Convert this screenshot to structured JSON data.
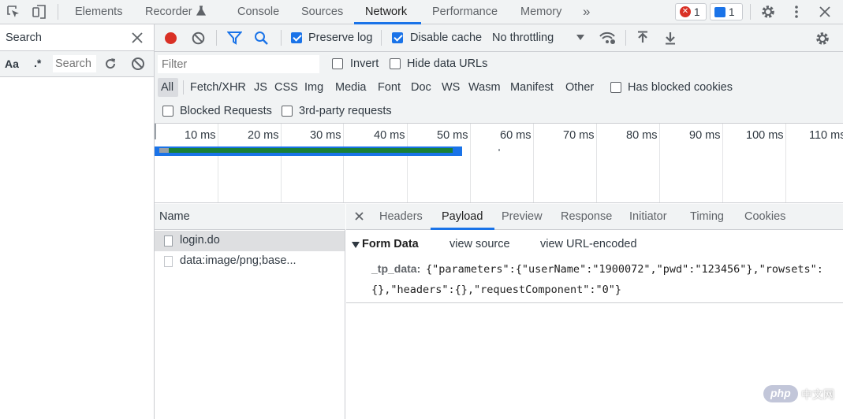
{
  "topbar": {
    "tabs": [
      {
        "label": "Elements"
      },
      {
        "label": "Recorder"
      },
      {
        "label": "Console"
      },
      {
        "label": "Sources"
      },
      {
        "label": "Network"
      },
      {
        "label": "Performance"
      },
      {
        "label": "Memory"
      }
    ],
    "active_tab": "Network",
    "more_tabs_glyph": "»",
    "error_count": "1",
    "message_count": "1"
  },
  "left_panel": {
    "title": "Search",
    "match_case_label": "Aa",
    "regex_label": ".*",
    "search_placeholder": "Search"
  },
  "network_toolbar": {
    "preserve_log_label": "Preserve log",
    "preserve_log_checked": true,
    "disable_cache_label": "Disable cache",
    "disable_cache_checked": true,
    "throttling_value": "No throttling"
  },
  "filter_bar": {
    "filter_placeholder": "Filter",
    "invert_label": "Invert",
    "hide_data_urls_label": "Hide data URLs",
    "type_filters": [
      "All",
      "Fetch/XHR",
      "JS",
      "CSS",
      "Img",
      "Media",
      "Font",
      "Doc",
      "WS",
      "Wasm",
      "Manifest",
      "Other"
    ],
    "active_type_filter": "All",
    "has_blocked_cookies_label": "Has blocked cookies",
    "blocked_requests_label": "Blocked Requests",
    "third_party_label": "3rd-party requests"
  },
  "timeline": {
    "ticks": [
      "10 ms",
      "20 ms",
      "30 ms",
      "40 ms",
      "50 ms",
      "60 ms",
      "70 ms",
      "80 ms",
      "90 ms",
      "100 ms",
      "110 ms"
    ]
  },
  "requests": {
    "name_header": "Name",
    "rows": [
      {
        "name": "login.do",
        "selected": true
      },
      {
        "name": "data:image/png;base...",
        "selected": false
      }
    ]
  },
  "details": {
    "tabs": [
      "Headers",
      "Payload",
      "Preview",
      "Response",
      "Initiator",
      "Timing",
      "Cookies"
    ],
    "active_tab": "Payload",
    "section_title": "Form Data",
    "view_source_label": "view source",
    "view_url_encoded_label": "view URL-encoded",
    "param_key": "_tp_data:",
    "param_value_line1": "{\"parameters\":{\"userName\":\"1900072\",\"pwd\":\"123456\"},\"rowsets\":",
    "param_value_line2": "{},\"headers\":{},\"requestComponent\":\"0\"}"
  },
  "watermark": {
    "logo_text": "php",
    "site_text": "中文网"
  },
  "colors": {
    "accent": "#1a73e8",
    "record_red": "#d93025",
    "toolbar_bg": "#f1f3f4",
    "selected_row_bg": "#dedfe1",
    "waterfall_blue": "#1a73e8",
    "waterfall_green": "#188038"
  }
}
